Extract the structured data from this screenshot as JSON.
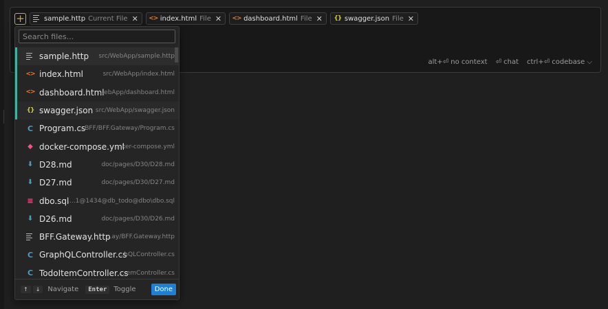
{
  "context_chips": [
    {
      "name": "sample.http",
      "tag": "Current File",
      "icon": "lines-icon"
    },
    {
      "name": "index.html",
      "tag": "File",
      "icon": "html-icon"
    },
    {
      "name": "dashboard.html",
      "tag": "File",
      "icon": "html-icon"
    },
    {
      "name": "swagger.json",
      "tag": "File",
      "icon": "json-icon"
    }
  ],
  "add_label": "+",
  "close_glyph": "✕",
  "hints": {
    "no_context": "alt+⏎ no context",
    "chat": "⏎ chat",
    "codebase": "ctrl+⏎ codebase ⌵"
  },
  "search": {
    "placeholder": "Search files...",
    "value": ""
  },
  "files": [
    {
      "name": "sample.http",
      "path": "src/WebApp/sample.http",
      "icon": "lines-icon",
      "selected": true
    },
    {
      "name": "index.html",
      "path": "src/WebApp/index.html",
      "icon": "html-icon",
      "selected": true
    },
    {
      "name": "dashboard.html",
      "path": "...ebApp/dashboard.html",
      "icon": "html-icon",
      "selected": true
    },
    {
      "name": "swagger.json",
      "path": "src/WebApp/swagger.json",
      "icon": "json-icon",
      "selected": true
    },
    {
      "name": "Program.cs",
      "path": "...BFF/BFF.Gateway/Program.cs",
      "icon": "csharp-icon",
      "selected": false
    },
    {
      "name": "docker-compose.yml",
      "path": "...ker-compose.yml",
      "icon": "docker-icon",
      "selected": false
    },
    {
      "name": "D28.md",
      "path": "doc/pages/D30/D28.md",
      "icon": "markdown-icon",
      "selected": false
    },
    {
      "name": "D27.md",
      "path": "doc/pages/D30/D27.md",
      "icon": "markdown-icon",
      "selected": false
    },
    {
      "name": "dbo.sql",
      "path": "....1@1434@db_todo@dbo\\dbo.sql",
      "icon": "database-icon",
      "selected": false
    },
    {
      "name": "D26.md",
      "path": "doc/pages/D30/D26.md",
      "icon": "markdown-icon",
      "selected": false
    },
    {
      "name": "BFF.Gateway.http",
      "path": "...ay/BFF.Gateway.http",
      "icon": "lines-icon",
      "selected": false
    },
    {
      "name": "GraphQLController.cs",
      "path": "...hQLController.cs",
      "icon": "csharp-icon",
      "selected": false
    },
    {
      "name": "TodoItemController.cs",
      "path": "...emController.cs",
      "icon": "csharp-icon",
      "selected": false
    }
  ],
  "footer": {
    "up_key": "↑",
    "down_key": "↓",
    "navigate": "Navigate",
    "enter_key": "Enter",
    "toggle": "Toggle",
    "done": "Done"
  }
}
